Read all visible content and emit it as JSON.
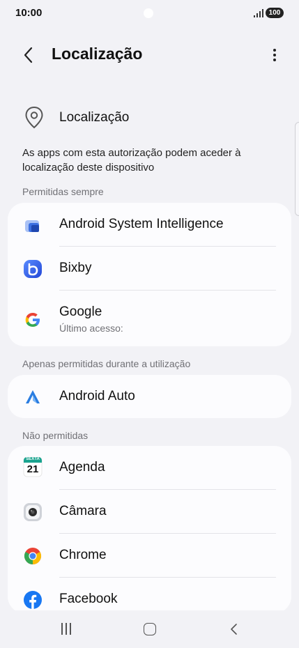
{
  "status_bar": {
    "time": "10:00",
    "battery": "100"
  },
  "header": {
    "title": "Localização"
  },
  "location_row": {
    "label": "Localização"
  },
  "description": "As apps com esta autorização podem aceder à localização deste dispositivo",
  "sections": [
    {
      "header": "Permitidas sempre",
      "items": [
        {
          "label": "Android System Intelligence",
          "icon": "android-system-intelligence-icon"
        },
        {
          "label": "Bixby",
          "icon": "bixby-icon"
        },
        {
          "label": "Google",
          "sublabel": "Último acesso:",
          "icon": "google-icon"
        }
      ]
    },
    {
      "header": "Apenas permitidas durante a utilização",
      "items": [
        {
          "label": "Android Auto",
          "icon": "android-auto-icon"
        }
      ]
    },
    {
      "header": "Não permitidas",
      "items": [
        {
          "label": "Agenda",
          "icon": "calendar-icon",
          "icon_text_top": "SEXTA",
          "icon_text_day": "21"
        },
        {
          "label": "Câmara",
          "icon": "camera-icon"
        },
        {
          "label": "Chrome",
          "icon": "chrome-icon"
        },
        {
          "label": "Facebook",
          "icon": "facebook-icon"
        }
      ]
    }
  ],
  "colors": {
    "background": "#f2f2f6",
    "card": "#fcfcfe",
    "secondary_text": "#707075",
    "bixby": "#3b6cf6",
    "facebook": "#1877f2"
  }
}
